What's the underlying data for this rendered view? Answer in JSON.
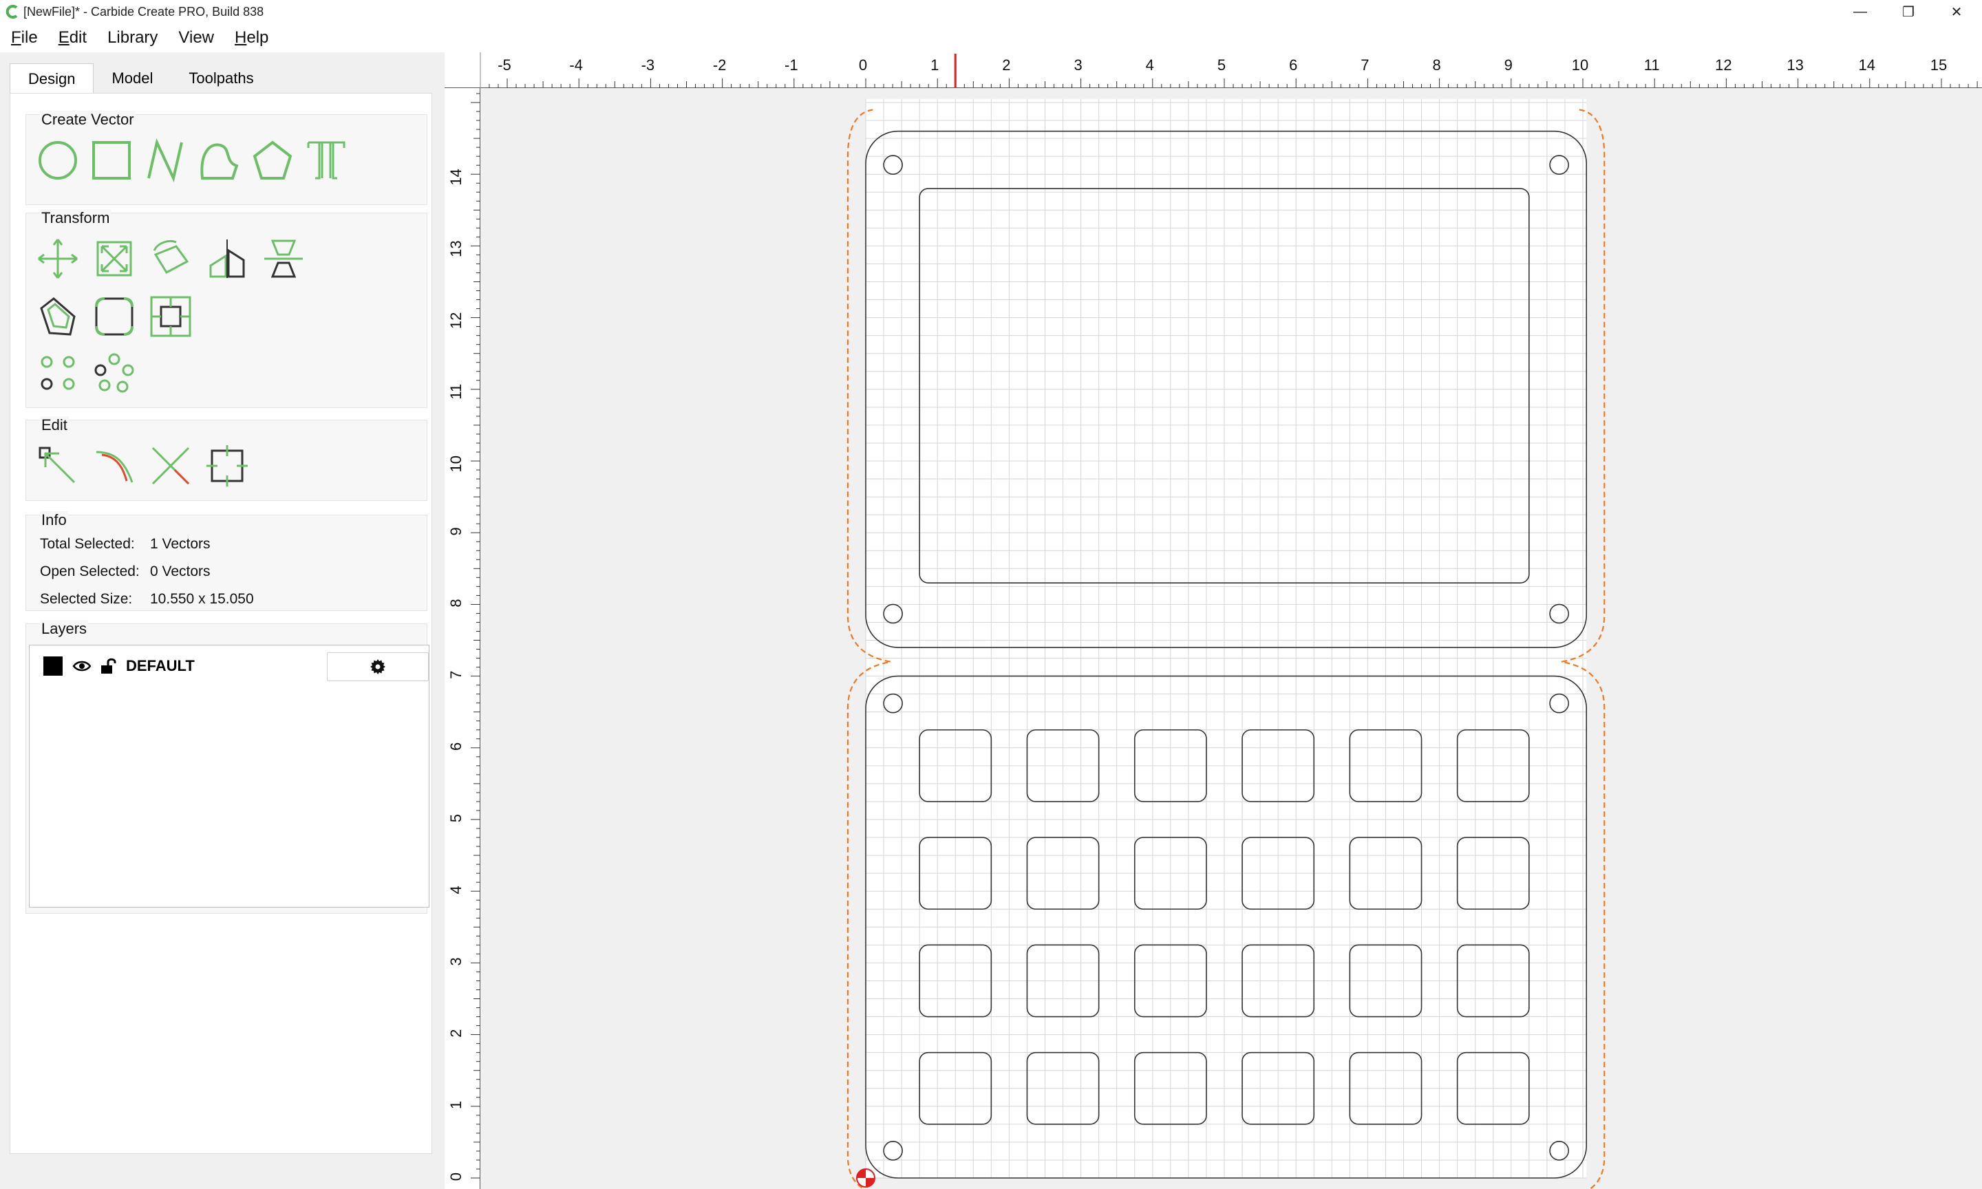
{
  "window": {
    "title": "[NewFile]* - Carbide Create PRO, Build 838",
    "controls": [
      "—",
      "❐",
      "✕"
    ]
  },
  "menu": [
    {
      "mnemonic": "F",
      "rest": "ile"
    },
    {
      "mnemonic": "E",
      "rest": "dit"
    },
    {
      "mnemonic": "",
      "rest": "Library"
    },
    {
      "mnemonic": "",
      "rest": "View"
    },
    {
      "mnemonic": "H",
      "rest": "elp"
    }
  ],
  "tabs": [
    "Design",
    "Model",
    "Toolpaths"
  ],
  "groups": {
    "create_vector": "Create Vector",
    "transform": "Transform",
    "edit": "Edit",
    "info": "Info",
    "layers": "Layers"
  },
  "info": {
    "total_selected_label": "Total Selected:",
    "total_selected_value": "1 Vectors",
    "open_selected_label": "Open Selected:",
    "open_selected_value": "0 Vectors",
    "selected_size_label": "Selected Size:",
    "selected_size_value": "10.550 x 15.050"
  },
  "layers": [
    {
      "name": "DEFAULT",
      "color": "#000000",
      "visible": true,
      "locked": false
    }
  ],
  "rulers": {
    "x_labels": [
      "-5",
      "-4",
      "-3",
      "-2",
      "-1",
      "0",
      "1",
      "2",
      "3",
      "4",
      "5",
      "6",
      "7",
      "8",
      "9",
      "10",
      "11",
      "12",
      "13",
      "14",
      "15"
    ],
    "y_labels": [
      "0",
      "1",
      "2",
      "3",
      "4",
      "5",
      "6",
      "7",
      "8",
      "9",
      "10",
      "11",
      "12",
      "13",
      "14"
    ],
    "cursor_x_value": 1.25
  },
  "colors": {
    "accent_green": "#6dbf67",
    "toolpath_orange": "#f07820",
    "cursor_red": "#e02020",
    "grid": "#d6d6d6"
  }
}
